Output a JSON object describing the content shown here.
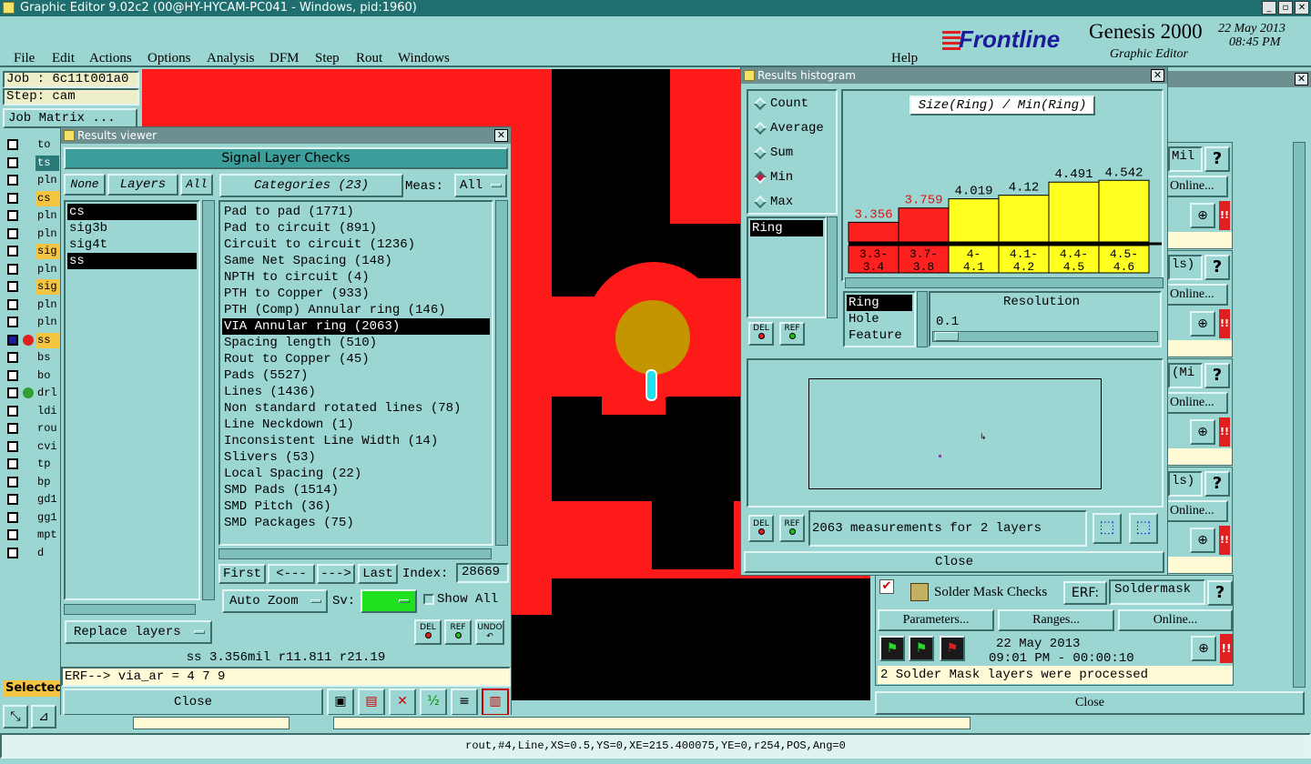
{
  "window": {
    "title": "Graphic Editor 9.02c2 (00@HY-HYCAM-PC041 - Windows, pid:1960)"
  },
  "menu": [
    "File",
    "Edit",
    "Actions",
    "Options",
    "Analysis",
    "DFM",
    "Step",
    "Rout",
    "Windows"
  ],
  "help": "Help",
  "brand": {
    "logo": "Frontline",
    "product": "Genesis 2000",
    "subtitle": "Graphic Editor",
    "date": "22 May 2013",
    "time": "08:45 PM"
  },
  "job": {
    "job": "Job : 6c11t001a0",
    "step": "Step: cam",
    "matrix": "Job Matrix ..."
  },
  "left_layers": [
    "to",
    "ts",
    "pln",
    "cs",
    "pln",
    "pln",
    "sig",
    "pln",
    "sig",
    "pln",
    "pln",
    "ss",
    "bs",
    "bo",
    "drl",
    "ldi",
    "rou",
    "cvi",
    "tp",
    "bp",
    "gd1",
    "gg1",
    "mpt",
    "d"
  ],
  "selected_label": "Selected",
  "results_viewer": {
    "title": "Results viewer",
    "header": "Signal Layer Checks",
    "none": "None",
    "layers": "Layers",
    "all": "All",
    "categories_label": "Categories (23)",
    "meas_label": "Meas:",
    "meas_value": "All",
    "layer_list": [
      "cs",
      "sig3b",
      "sig4t",
      "ss"
    ],
    "categories": [
      "Pad to pad (1771)",
      "Pad to circuit (891)",
      "Circuit to circuit (1236)",
      "Same Net Spacing (148)",
      "NPTH to circuit (4)",
      "PTH to Copper (933)",
      "PTH (Comp) Annular ring (146)",
      "VIA Annular ring (2063)",
      "Spacing length (510)",
      "Rout to Copper (45)",
      "Pads (5527)",
      "Lines (1436)",
      "Non standard rotated lines (78)",
      "Line Neckdown (1)",
      "Inconsistent Line Width (14)",
      "Slivers (53)",
      "Local Spacing (22)",
      "SMD Pads (1514)",
      "SMD Pitch (36)",
      "SMD Packages (75)"
    ],
    "first": "First",
    "prev": "<---",
    "next": "--->",
    "last": "Last",
    "index_label": "Index:",
    "index_value": "28669",
    "auto_zoom": "Auto Zoom",
    "sv_label": "Sv:",
    "show_all": "Show All",
    "replace_layers": "Replace layers",
    "del": "DEL",
    "ref": "REF",
    "undo": "UNDO",
    "status": "ss 3.356mil  r11.811  r21.19",
    "erf": "ERF--> via_ar = 4 7 9",
    "close": "Close"
  },
  "histogram": {
    "title": "Results histogram",
    "modes": [
      "Count",
      "Average",
      "Sum",
      "Min",
      "Max"
    ],
    "selected_mode": "Min",
    "chart_title": "Size(Ring) / Min(Ring)",
    "ring_label": "Ring",
    "fields": [
      "Ring",
      "Hole",
      "Feature"
    ],
    "resolution_label": "Resolution",
    "resolution_value": "0.1",
    "measurements": "2063 measurements for 2 layers",
    "close": "Close",
    "del": "DEL",
    "ref": "REF",
    "red_color": "#ff2020",
    "yellow_color": "#ffff20"
  },
  "chart_data": {
    "type": "bar",
    "title": "Size(Ring) / Min(Ring)",
    "categories": [
      "3.3-3.4",
      "3.7-3.8",
      "4-4.1",
      "4.1-4.2",
      "4.4-4.5",
      "4.5-4.6"
    ],
    "values": [
      3.356,
      3.759,
      4.019,
      4.12,
      4.491,
      4.542
    ],
    "labels": [
      "3.356",
      "3.759",
      "4.019",
      "4.12",
      "4.491",
      "4.542"
    ],
    "cat_top": [
      "3.3-",
      "3.7-",
      "4-",
      "4.1-",
      "4.4-",
      "4.5-"
    ],
    "cat_bot": [
      "3.4",
      "3.8",
      "4.1",
      "4.2",
      "4.5",
      "4.6"
    ],
    "colors": [
      "red",
      "red",
      "yellow",
      "yellow",
      "yellow",
      "yellow"
    ]
  },
  "checks_panel": {
    "rows": [
      {
        "text": "Mil"
      },
      {
        "text": "ls)"
      },
      {
        "text": "(Mi"
      },
      {
        "text": "ls)"
      }
    ],
    "online": "Online...",
    "solder_title": "Solder Mask Checks",
    "erf_label": "ERF:",
    "erf_value": "Soldermask",
    "parameters": "Parameters...",
    "ranges": "Ranges...",
    "online2": "Online...",
    "date": "22 May 2013",
    "time": "09:01 PM - 00:00:10",
    "processed": "2 Solder Mask layers were processed",
    "close": "Close"
  },
  "statusbar": "rout,#4,Line,XS=0.5,YS=0,XE=215.400075,YE=0,r254,POS,Ang=0"
}
